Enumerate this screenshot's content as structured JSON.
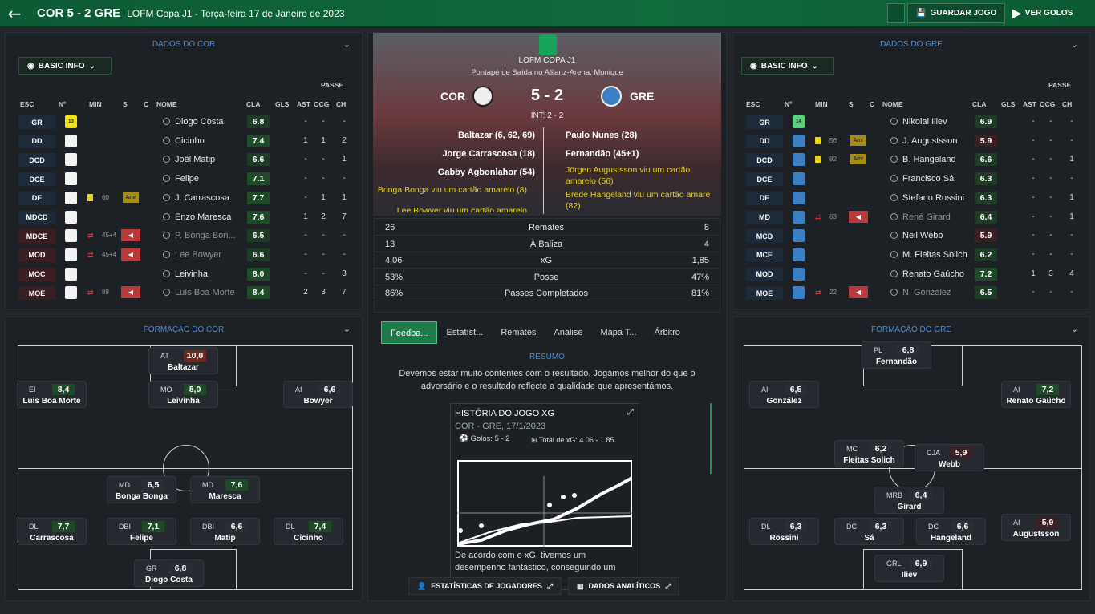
{
  "top": {
    "score": "COR 5 - 2 GRE",
    "info": "LOFM Copa J1 - Terça-feira 17 de Janeiro de 2023",
    "save": "GUARDAR JOGO",
    "goals": "VER GOLOS"
  },
  "left": {
    "title": "DADOS DO COR",
    "basic": "BASIC INFO",
    "formation_title": "FORMAÇÃO DO COR"
  },
  "right": {
    "title": "DADOS DO GRE",
    "basic": "BASIC INFO",
    "formation_title": "FORMAÇÃO DO GRE"
  },
  "cols": {
    "esc": "ESC",
    "num": "Nº",
    "min": "MIN",
    "s": "S",
    "c": "C",
    "nome": "NOME",
    "cla": "CLA",
    "gls": "GLS",
    "ast": "AST",
    "ocg": "OCG",
    "ch": "CH",
    "passe": "PASSE"
  },
  "cor_players": [
    {
      "pos": "GR",
      "num": "13",
      "name": "Diogo Costa",
      "rat": "6.8",
      "ast": "-",
      "ocg": "-",
      "ch": "-"
    },
    {
      "pos": "DD",
      "num": "",
      "name": "Cicinho",
      "rat": "7.4",
      "ast": "1",
      "ocg": "1",
      "ch": "2"
    },
    {
      "pos": "DCD",
      "num": "",
      "name": "Joël Matip",
      "rat": "6.6",
      "ast": "-",
      "ocg": "-",
      "ch": "1"
    },
    {
      "pos": "DCE",
      "num": "",
      "name": "Felipe",
      "rat": "7.1",
      "ast": "-",
      "ocg": "-",
      "ch": "-"
    },
    {
      "pos": "DE",
      "num": "",
      "name": "J. Carrascosa",
      "rat": "7.7",
      "min": "60",
      "card": "Amr",
      "ast": "-",
      "ocg": "1",
      "ch": "1"
    },
    {
      "pos": "MDCD",
      "num": "",
      "name": "Enzo Maresca",
      "rat": "7.6",
      "ast": "1",
      "ocg": "2",
      "ch": "7"
    },
    {
      "pos": "MDCE",
      "num": "",
      "name": "P. Bonga Bon...",
      "rat": "6.5",
      "min": "45+4",
      "ast": "-",
      "ocg": "-",
      "ch": "-"
    },
    {
      "pos": "MOD",
      "num": "",
      "name": "Lee Bowyer",
      "rat": "6.6",
      "min": "45+4",
      "ast": "-",
      "ocg": "-",
      "ch": "-"
    },
    {
      "pos": "MOC",
      "num": "",
      "name": "Leivinha",
      "rat": "8.0",
      "ast": "-",
      "ocg": "-",
      "ch": "3"
    },
    {
      "pos": "MOE",
      "num": "",
      "name": "Luís Boa Morte",
      "rat": "8.4",
      "min": "89",
      "ast": "2",
      "ocg": "3",
      "ch": "7"
    }
  ],
  "gre_players": [
    {
      "pos": "GR",
      "num": "14",
      "name": "Nikolai Iliev",
      "rat": "6.9",
      "ast": "-",
      "ocg": "-",
      "ch": "-"
    },
    {
      "pos": "DD",
      "num": "",
      "name": "J. Augustsson",
      "rat": "5.9",
      "min": "56",
      "card": "Amr",
      "ast": "-",
      "ocg": "-",
      "ch": "-"
    },
    {
      "pos": "DCD",
      "num": "",
      "name": "B. Hangeland",
      "rat": "6.6",
      "min": "82",
      "card": "Amr",
      "ast": "-",
      "ocg": "-",
      "ch": "1"
    },
    {
      "pos": "DCE",
      "num": "",
      "name": "Francisco Sá",
      "rat": "6.3",
      "ast": "-",
      "ocg": "-",
      "ch": "-"
    },
    {
      "pos": "DE",
      "num": "",
      "name": "Stefano Rossini",
      "rat": "6.3",
      "ast": "-",
      "ocg": "-",
      "ch": "1"
    },
    {
      "pos": "MD",
      "num": "",
      "name": "René Girard",
      "rat": "6.4",
      "min": "63",
      "ast": "-",
      "ocg": "-",
      "ch": "1"
    },
    {
      "pos": "MCD",
      "num": "",
      "name": "Neil Webb",
      "rat": "5.9",
      "ast": "-",
      "ocg": "-",
      "ch": "-"
    },
    {
      "pos": "MCE",
      "num": "",
      "name": "M. Fleitas Solich",
      "rat": "6.2",
      "ast": "-",
      "ocg": "-",
      "ch": "-"
    },
    {
      "pos": "MOD",
      "num": "",
      "name": "Renato Gaúcho",
      "rat": "7.2",
      "ast": "1",
      "ocg": "3",
      "ch": "4"
    },
    {
      "pos": "MOE",
      "num": "",
      "name": "N. González",
      "rat": "6.5",
      "min": "22",
      "ast": "-",
      "ocg": "-",
      "ch": "-"
    }
  ],
  "match": {
    "comp": "LOFM COPA J1",
    "venue": "Pontapé de Saída no Allianz-Arena, Munique",
    "home": "COR",
    "away": "GRE",
    "score": "5 - 2",
    "ht": "INT: 2 - 2",
    "home_events": [
      "Baltazar (6, 62, 69)",
      "Jorge Carrascosa (18)",
      "Gabby Agbonlahor (54)",
      "Bonga Bonga viu um cartão amarelo (8)",
      "Lee Bowyer viu um cartão amarelo"
    ],
    "away_events": [
      "Paulo Nunes (28)",
      "Fernandão (45+1)",
      "Jörgen Augustsson viu um cartão amarelo (56)",
      "Brede Hangeland viu um cartão amare (82)"
    ]
  },
  "stats": [
    {
      "h": "26",
      "l": "Remates",
      "a": "8"
    },
    {
      "h": "13",
      "l": "À Baliza",
      "a": "4"
    },
    {
      "h": "4,06",
      "l": "xG",
      "a": "1,85"
    },
    {
      "h": "53%",
      "l": "Posse",
      "a": "47%"
    },
    {
      "h": "86%",
      "l": "Passes Completados",
      "a": "81%"
    }
  ],
  "tabs": [
    "Feedba...",
    "Estatíst...",
    "Remates",
    "Análise",
    "Mapa T...",
    "Árbitro"
  ],
  "summary": {
    "title": "RESUMO",
    "text": "Devemos estar muito contentes com o resultado. Jogámos melhor do que o adversário e o resultado reflecte a qualidade que apresentámos."
  },
  "xg": {
    "title": "HISTÓRIA DO JOGO XG",
    "sub": "COR - GRE, 17/1/2023",
    "goals": "Golos: 5 - 2",
    "total": "Total de xG: 4.06 - 1.85",
    "note": "De acordo com o xG, tivemos um desempenho fantástico, conseguindo um"
  },
  "buttons": {
    "players": "ESTATÍSTICAS DE JOGADORES",
    "analytics": "DADOS ANALÍTICOS"
  },
  "cor_form": [
    {
      "p": "AT",
      "r": "10,0",
      "n": "Baltazar"
    },
    {
      "p": "EI",
      "r": "8,4",
      "n": "Luis Boa Morte"
    },
    {
      "p": "MO",
      "r": "8,0",
      "n": "Leivinha"
    },
    {
      "p": "AI",
      "r": "6,6",
      "n": "Bowyer"
    },
    {
      "p": "MD",
      "r": "6,5",
      "n": "Bonga Bonga"
    },
    {
      "p": "MD",
      "r": "7,6",
      "n": "Maresca"
    },
    {
      "p": "DL",
      "r": "7,7",
      "n": "Carrascosa"
    },
    {
      "p": "DBI",
      "r": "7,1",
      "n": "Felipe"
    },
    {
      "p": "DBI",
      "r": "6,6",
      "n": "Matip"
    },
    {
      "p": "DL",
      "r": "7,4",
      "n": "Cicinho"
    },
    {
      "p": "GR",
      "r": "6,8",
      "n": "Diogo Costa"
    }
  ],
  "gre_form": [
    {
      "p": "PL",
      "r": "6,8",
      "n": "Fernandão"
    },
    {
      "p": "AI",
      "r": "6,5",
      "n": "González"
    },
    {
      "p": "AI",
      "r": "7,2",
      "n": "Renato Gaúcho"
    },
    {
      "p": "MC",
      "r": "6,2",
      "n": "Fleitas Solich"
    },
    {
      "p": "CJA",
      "r": "5,9",
      "n": "Webb"
    },
    {
      "p": "MRB",
      "r": "6,4",
      "n": "Girard"
    },
    {
      "p": "DL",
      "r": "6,3",
      "n": "Rossini"
    },
    {
      "p": "DC",
      "r": "6,3",
      "n": "Sá"
    },
    {
      "p": "DC",
      "r": "6,6",
      "n": "Hangeland"
    },
    {
      "p": "AI",
      "r": "5,9",
      "n": "Augustsson"
    },
    {
      "p": "GRL",
      "r": "6,9",
      "n": "Iliev"
    }
  ]
}
